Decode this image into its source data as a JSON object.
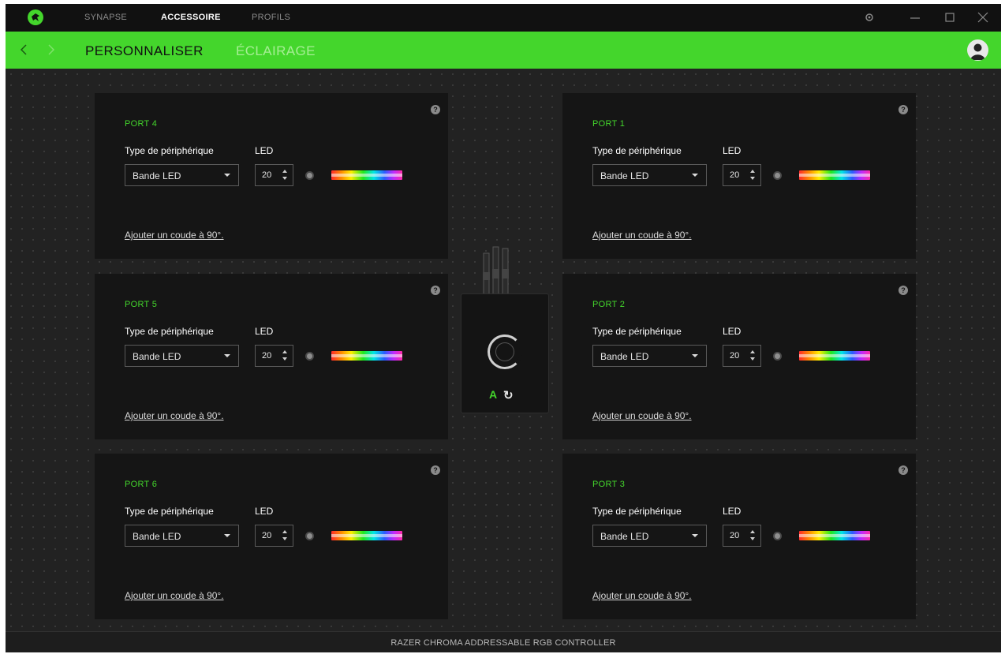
{
  "titlebar": {
    "tabs": [
      {
        "label": "SYNAPSE",
        "active": false
      },
      {
        "label": "ACCESSOIRE",
        "active": true
      },
      {
        "label": "PROFILS",
        "active": false
      }
    ],
    "icons": [
      "gear-icon",
      "minimize-icon",
      "maximize-icon",
      "close-icon"
    ]
  },
  "navbar": {
    "accent_color": "#44d62c",
    "tabs": [
      {
        "label": "PERSONNALISER",
        "active": true
      },
      {
        "label": "ÉCLAIRAGE",
        "active": false
      }
    ],
    "icons": [
      "back-arrow-icon",
      "forward-arrow-icon",
      "user-avatar-icon"
    ]
  },
  "ports": [
    {
      "port": "PORT 4",
      "type_label": "Type de périphérique",
      "led_label": "LED",
      "device_type": "Bande LED",
      "led_count": "20",
      "link": "Ajouter un coude à 90°."
    },
    {
      "port": "PORT 1",
      "type_label": "Type de périphérique",
      "led_label": "LED",
      "device_type": "Bande LED",
      "led_count": "20",
      "link": "Ajouter un coude à 90°."
    },
    {
      "port": "PORT 5",
      "type_label": "Type de périphérique",
      "led_label": "LED",
      "device_type": "Bande LED",
      "led_count": "20",
      "link": "Ajouter un coude à 90°."
    },
    {
      "port": "PORT 2",
      "type_label": "Type de périphérique",
      "led_label": "LED",
      "device_type": "Bande LED",
      "led_count": "20",
      "link": "Ajouter un coude à 90°."
    },
    {
      "port": "PORT 6",
      "type_label": "Type de périphérique",
      "led_label": "LED",
      "device_type": "Bande LED",
      "led_count": "20",
      "link": "Ajouter un coude à 90°."
    },
    {
      "port": "PORT 3",
      "type_label": "Type de périphérique",
      "led_label": "LED",
      "device_type": "Bande LED",
      "led_count": "20",
      "link": "Ajouter un coude à 90°."
    }
  ],
  "device": {
    "a_label": "A",
    "refresh_icon": "refresh-icon"
  },
  "statusbar": {
    "device_name": "RAZER CHROMA ADDRESSABLE RGB CONTROLLER"
  }
}
